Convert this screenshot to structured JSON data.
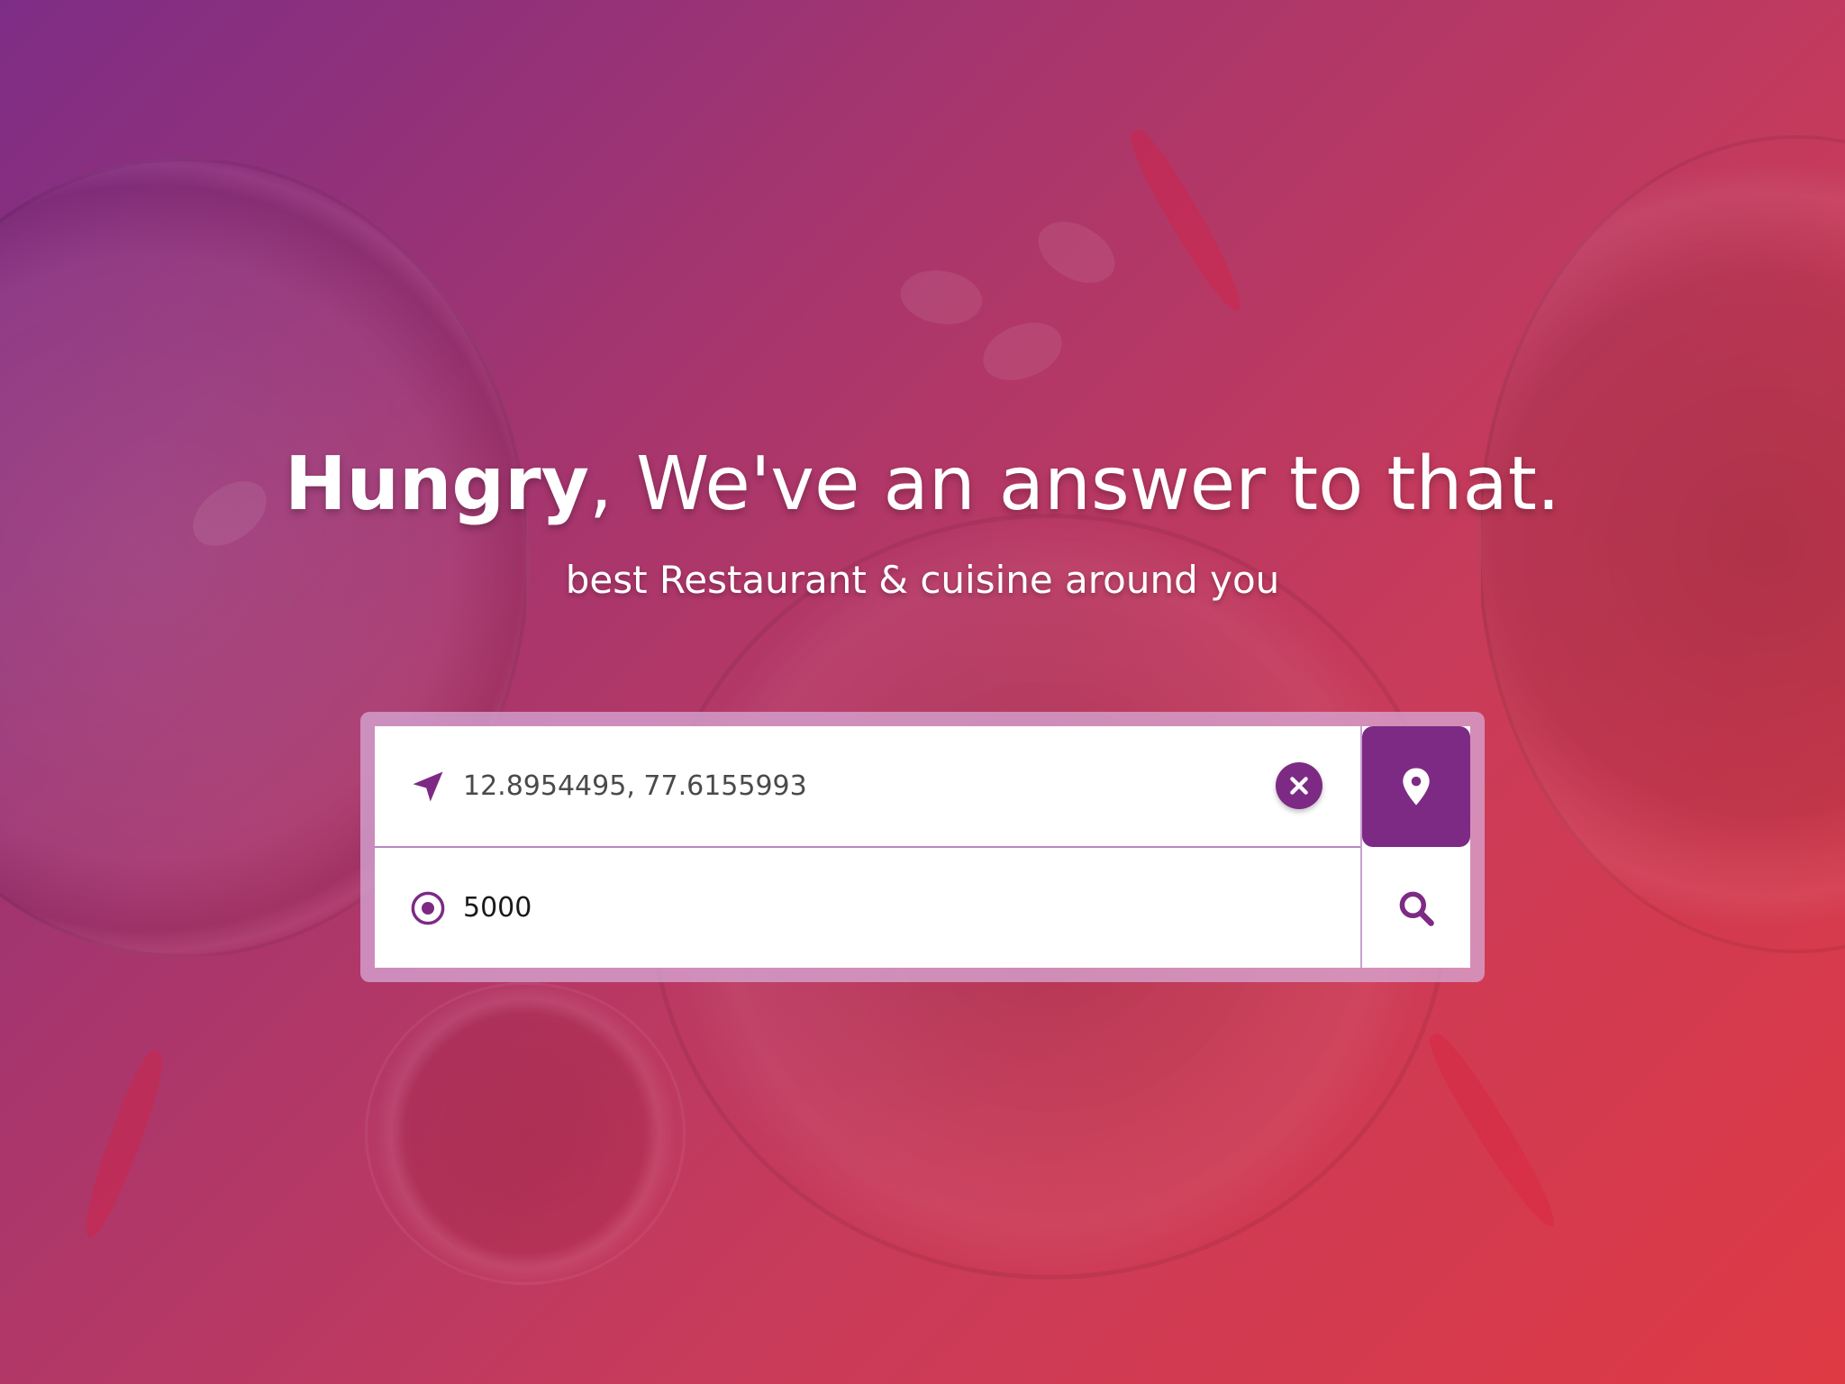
{
  "hero": {
    "headline_strong": "Hungry",
    "headline_rest": ", We've an answer to that.",
    "subtitle": "best Restaurant & cuisine around you"
  },
  "search": {
    "location_value": "12.8954495, 77.6155993",
    "radius_value": "5000"
  },
  "icons": {
    "location_lead": "navigation-arrow-icon",
    "radius_lead": "radio-target-icon",
    "clear": "close-icon",
    "locate": "map-pin-icon",
    "search": "search-icon"
  },
  "colors": {
    "accent": "#7d2a85",
    "gradient_start": "#7e2d86",
    "gradient_end": "#de3a44",
    "card_frame": "#d7aad7",
    "divider": "#b986c2"
  }
}
